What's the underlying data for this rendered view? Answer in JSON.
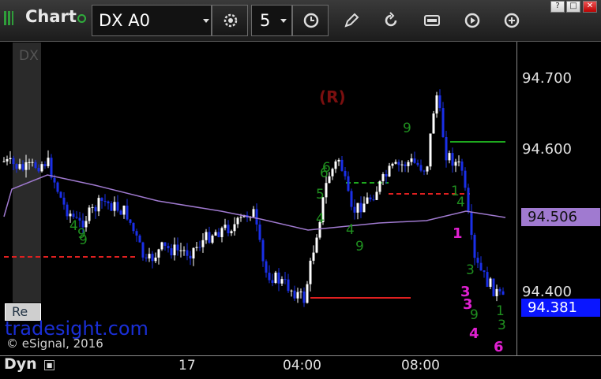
{
  "toolbar": {
    "title": "Chart",
    "symbol": "DX A0",
    "interval": "5",
    "window_buttons": [
      "?",
      "□",
      "✕"
    ]
  },
  "chart": {
    "symbol_overlay": "DX",
    "marker_r": "(R)",
    "watermark": "tradesight.com",
    "copyright": "© eSignal, 2016",
    "re_button": "Re",
    "price_axis": [
      "94.700",
      "94.600",
      "94.400"
    ],
    "current_price": "94.381",
    "ma_value": "94.506",
    "colors": {
      "up": "#ffffff",
      "down": "#1a2fe8",
      "ma": "#a07ad0",
      "red_level": "#e02020",
      "green_level": "#1ea81e",
      "count_green": "#1f8f1f",
      "count_magenta": "#e020d0",
      "price_tag": "#0a16ff",
      "ma_tag": "#a07ad0"
    },
    "magenta_counts": [
      "1",
      "3",
      "3",
      "4",
      "6"
    ],
    "green_counts": [
      "9",
      "9",
      "4",
      "9",
      "6",
      "5",
      "4",
      "4",
      "6",
      "9",
      "1",
      "4",
      "3",
      "9",
      "1",
      "3"
    ]
  },
  "timebar": {
    "mode": "Dyn",
    "labels": [
      "17",
      "04:00",
      "08:00"
    ]
  }
}
